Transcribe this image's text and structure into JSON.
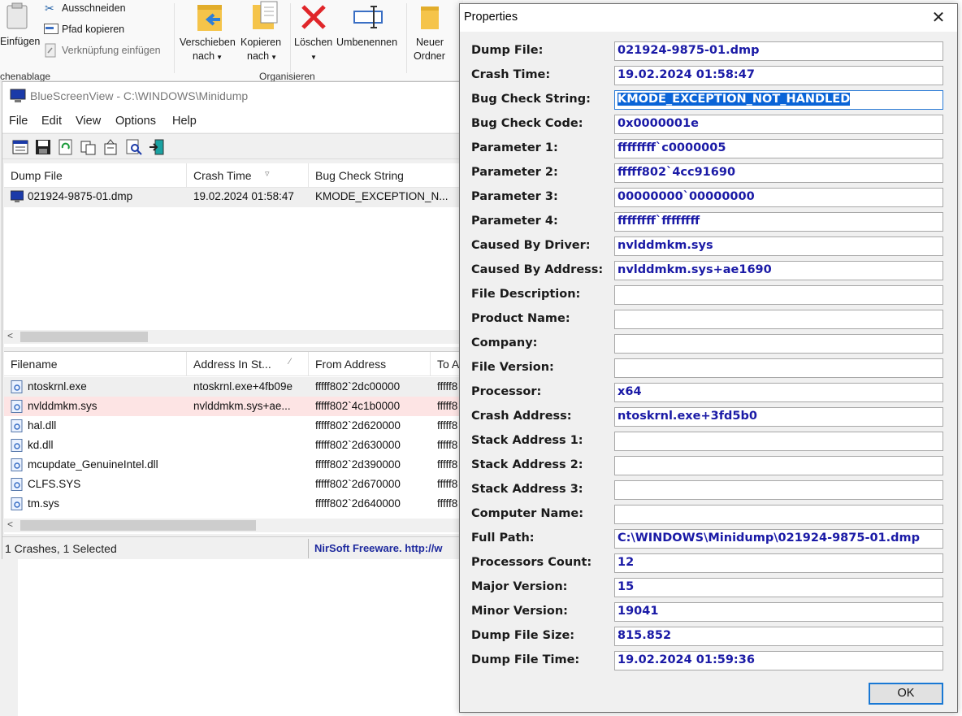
{
  "ribbon": {
    "cut_label": "Ausschneiden",
    "copy_path_label": "Pfad kopieren",
    "paste_shortcut_label": "Verknüpfung einfügen",
    "paste_label": "Einfügen",
    "clipboard_group": "chenablage",
    "move_to_label_1": "Verschieben",
    "move_to_label_2": "nach",
    "copy_to_label_1": "Kopieren",
    "copy_to_label_2": "nach",
    "delete_label": "Löschen",
    "rename_label": "Umbenennen",
    "organize_group": "Organisieren",
    "new_folder_label_1": "Neuer",
    "new_folder_label_2": "Ordner"
  },
  "bsv": {
    "title": "BlueScreenView  -  C:\\WINDOWS\\Minidump",
    "menu": [
      "File",
      "Edit",
      "View",
      "Options",
      "Help"
    ],
    "crash_columns": [
      "Dump File",
      "Crash Time",
      "Bug Check String"
    ],
    "crash_rows": [
      {
        "dump_file": "021924-9875-01.dmp",
        "crash_time": "19.02.2024 01:58:47",
        "bug_check": "KMODE_EXCEPTION_N..."
      }
    ],
    "driver_columns": [
      "Filename",
      "Address In St...",
      "From Address",
      "To A"
    ],
    "driver_rows": [
      {
        "filename": "ntoskrnl.exe",
        "address_in_stack": "ntoskrnl.exe+4fb09e",
        "from_address": "fffff802`2dc00000",
        "to_address": "fffff8"
      },
      {
        "filename": "nvlddmkm.sys",
        "address_in_stack": "nvlddmkm.sys+ae...",
        "from_address": "fffff802`4c1b0000",
        "to_address": "fffff8"
      },
      {
        "filename": "hal.dll",
        "address_in_stack": "",
        "from_address": "fffff802`2d620000",
        "to_address": "fffff8"
      },
      {
        "filename": "kd.dll",
        "address_in_stack": "",
        "from_address": "fffff802`2d630000",
        "to_address": "fffff8"
      },
      {
        "filename": "mcupdate_GenuineIntel.dll",
        "address_in_stack": "",
        "from_address": "fffff802`2d390000",
        "to_address": "fffff8"
      },
      {
        "filename": "CLFS.SYS",
        "address_in_stack": "",
        "from_address": "fffff802`2d670000",
        "to_address": "fffff8"
      },
      {
        "filename": "tm.sys",
        "address_in_stack": "",
        "from_address": "fffff802`2d640000",
        "to_address": "fffff8"
      }
    ],
    "status_left": "1 Crashes, 1 Selected",
    "status_right": "NirSoft Freeware.  http://w"
  },
  "dialog": {
    "title": "Properties",
    "close_glyph": "✕",
    "ok_label": "OK",
    "fields": [
      {
        "label": "Dump File:",
        "value": "021924-9875-01.dmp"
      },
      {
        "label": "Crash Time:",
        "value": "19.02.2024 01:58:47"
      },
      {
        "label": "Bug Check String:",
        "value": "KMODE_EXCEPTION_NOT_HANDLED"
      },
      {
        "label": "Bug Check Code:",
        "value": "0x0000001e"
      },
      {
        "label": "Parameter 1:",
        "value": "ffffffff`c0000005"
      },
      {
        "label": "Parameter 2:",
        "value": "fffff802`4cc91690"
      },
      {
        "label": "Parameter 3:",
        "value": "00000000`00000000"
      },
      {
        "label": "Parameter 4:",
        "value": "ffffffff`ffffffff"
      },
      {
        "label": "Caused By Driver:",
        "value": "nvlddmkm.sys"
      },
      {
        "label": "Caused By Address:",
        "value": "nvlddmkm.sys+ae1690"
      },
      {
        "label": "File Description:",
        "value": ""
      },
      {
        "label": "Product Name:",
        "value": ""
      },
      {
        "label": "Company:",
        "value": ""
      },
      {
        "label": "File Version:",
        "value": ""
      },
      {
        "label": "Processor:",
        "value": "x64"
      },
      {
        "label": "Crash Address:",
        "value": "ntoskrnl.exe+3fd5b0"
      },
      {
        "label": "Stack Address 1:",
        "value": ""
      },
      {
        "label": "Stack Address 2:",
        "value": ""
      },
      {
        "label": "Stack Address 3:",
        "value": ""
      },
      {
        "label": "Computer Name:",
        "value": ""
      },
      {
        "label": "Full Path:",
        "value": "C:\\WINDOWS\\Minidump\\021924-9875-01.dmp"
      },
      {
        "label": "Processors Count:",
        "value": "12"
      },
      {
        "label": "Major Version:",
        "value": "15"
      },
      {
        "label": "Minor Version:",
        "value": "19041"
      },
      {
        "label": "Dump File Size:",
        "value": "815.852"
      },
      {
        "label": "Dump File Time:",
        "value": "19.02.2024 01:59:36"
      }
    ]
  },
  "colors": {
    "field_text": "#1a1aa6",
    "selection": "#0a64d7",
    "highlight_row": "#fde4e4",
    "nirsoft_link": "#1e2a9e"
  }
}
